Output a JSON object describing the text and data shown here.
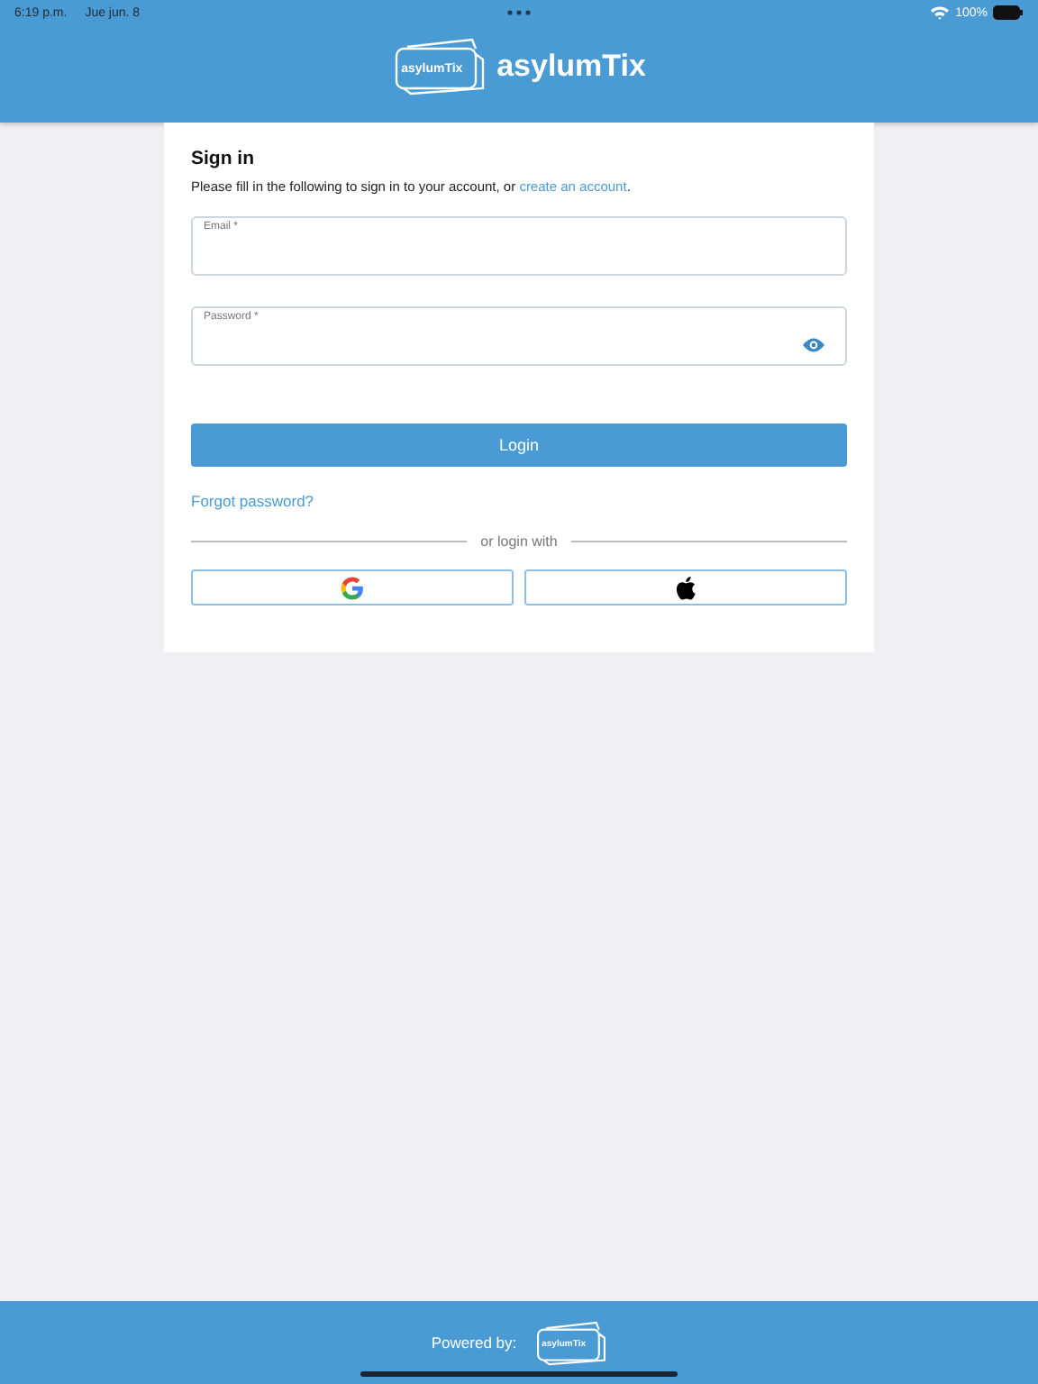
{
  "status_bar": {
    "time": "6:19 p.m.",
    "date": "Jue jun. 8",
    "battery": "100%"
  },
  "header": {
    "logo_badge": "asylumTix",
    "brand": "asylumTix"
  },
  "sign_in": {
    "title": "Sign in",
    "intro": "Please fill in the following to sign in to your account, or ",
    "intro_link": "create an account",
    "intro_end": ".",
    "fields": [
      {
        "label": "Email *",
        "kind": "text"
      },
      {
        "label": "Password *",
        "kind": "password"
      }
    ],
    "login_button": "Login",
    "forgot_link": "Forgot password?",
    "divider_text": "or login with",
    "social_buttons": [
      {
        "kind": "google"
      },
      {
        "kind": "apple"
      }
    ]
  },
  "footer": {
    "text": "Powered by:",
    "logo_badge": "asylumTix"
  }
}
